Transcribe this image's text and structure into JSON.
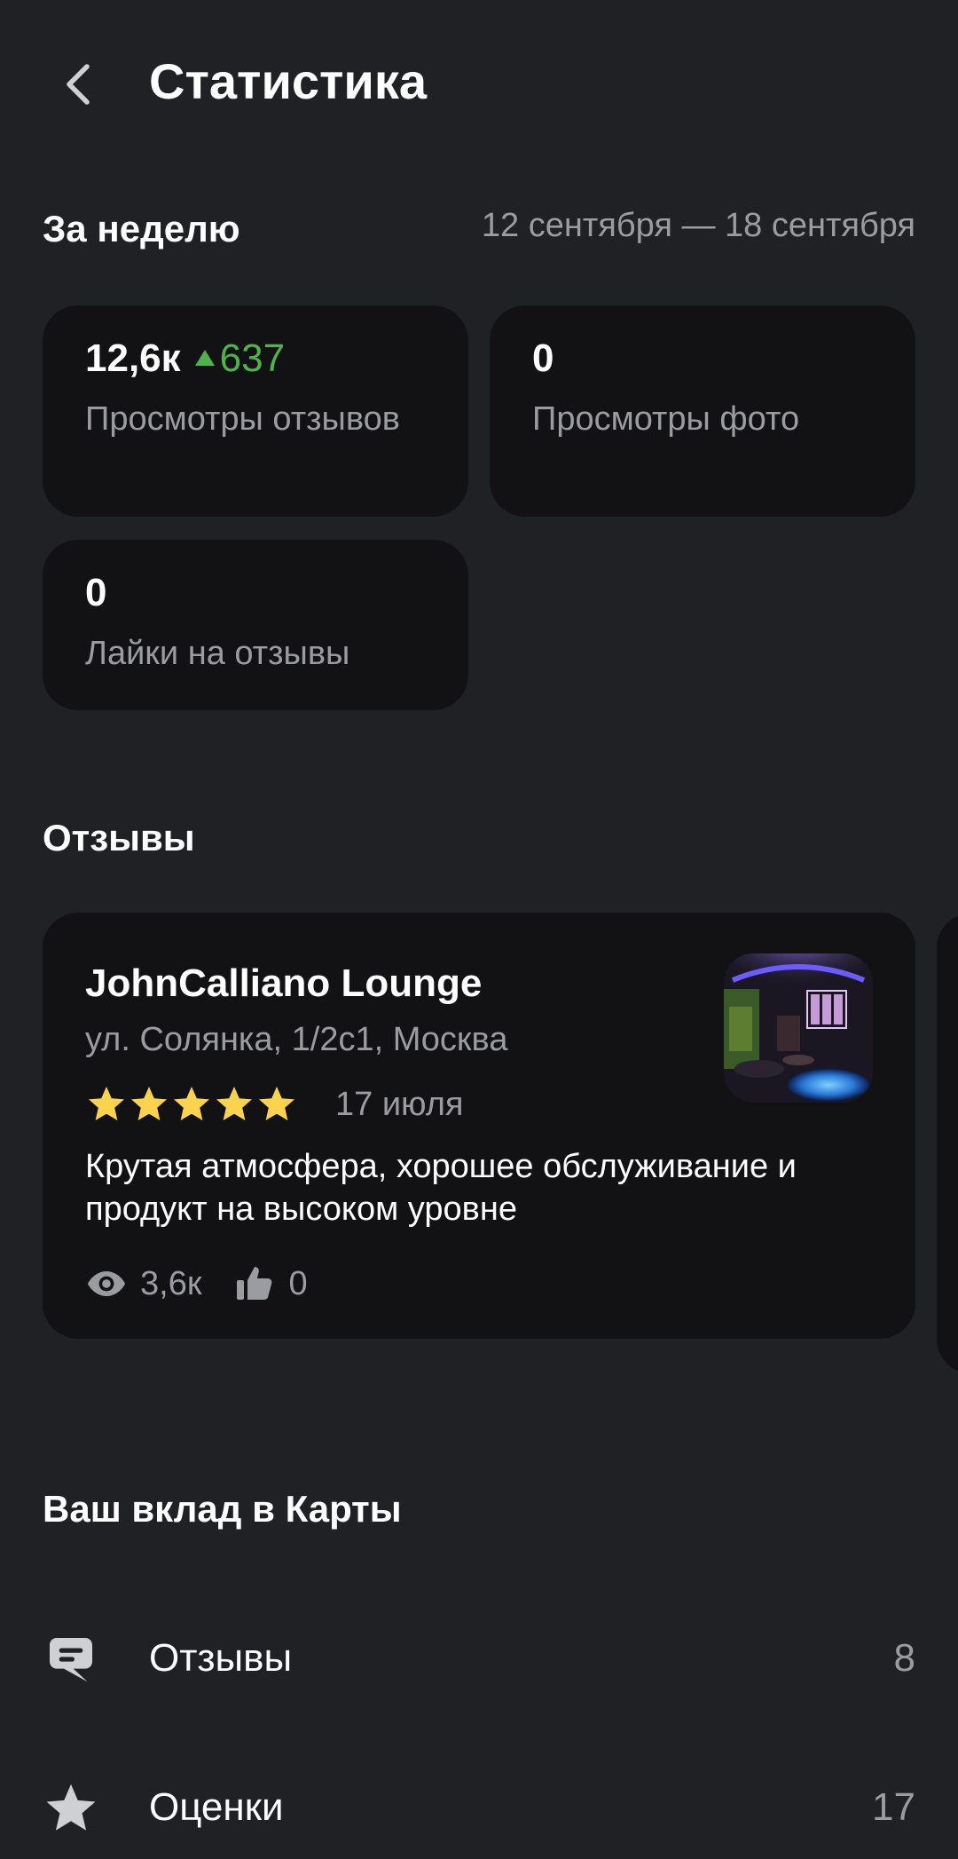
{
  "header": {
    "title": "Статистика"
  },
  "week": {
    "heading": "За неделю",
    "range": "12 сентября — 18 сентября"
  },
  "stats": [
    {
      "value": "12,6к",
      "delta": "637",
      "label": "Просмотры отзывов"
    },
    {
      "value": "0",
      "label": "Просмотры фото"
    },
    {
      "value": "0",
      "label": "Лайки на отзывы"
    }
  ],
  "reviews_section": {
    "title": "Отзывы",
    "items": [
      {
        "org_name": "JohnCalliano Lounge",
        "address": "ул. Солянка, 1/2с1, Москва",
        "rating": 5,
        "date": "17 июля",
        "text": "Крутая атмосфера, хорошее обслуживание и продукт на высоком уровне",
        "views": "3,6к",
        "likes": "0"
      }
    ]
  },
  "contribution": {
    "title": "Ваш вклад в Карты",
    "items": [
      {
        "label": "Отзывы",
        "count": "8",
        "icon": "review-bubble-icon"
      },
      {
        "label": "Оценки",
        "count": "17",
        "icon": "star-icon"
      }
    ]
  },
  "colors": {
    "background": "#202125",
    "card": "#121214",
    "secondary_text": "#9b9ca1",
    "positive_delta": "#4fb34c",
    "star": "#fcd34f"
  }
}
